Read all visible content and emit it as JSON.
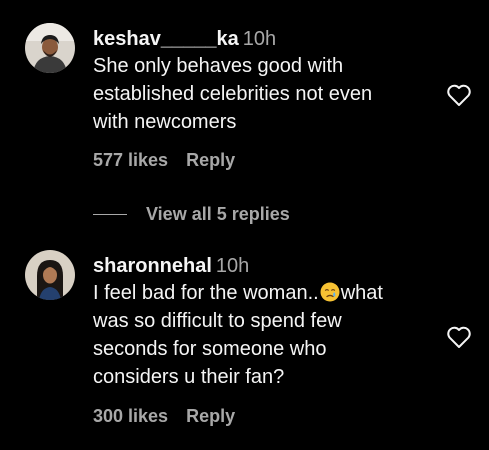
{
  "comments": [
    {
      "username": "keshav_____ka",
      "time": "10h",
      "text": "She only behaves good with\nestablished celebrities not even\nwith newcomers",
      "likes": "577 likes",
      "reply_label": "Reply",
      "avatar_icon": "avatar-photo-man",
      "like_icon": "heart-outline-icon"
    },
    {
      "username": "sharonnehal",
      "time": "10h",
      "text_part1": "I feel bad for the woman..",
      "text_emoji": "crying-face-emoji",
      "text_part2": "what\nwas so difficult to spend few\nseconds for someone who\nconsiders u their fan?",
      "likes": "300 likes",
      "reply_label": "Reply",
      "avatar_icon": "avatar-photo-woman",
      "like_icon": "heart-outline-icon"
    }
  ],
  "thread": {
    "view_replies_label": "View all 5 replies"
  },
  "colors": {
    "background": "#000000",
    "primary_text": "#f5f5f5",
    "secondary_text": "#a8a8a8"
  }
}
